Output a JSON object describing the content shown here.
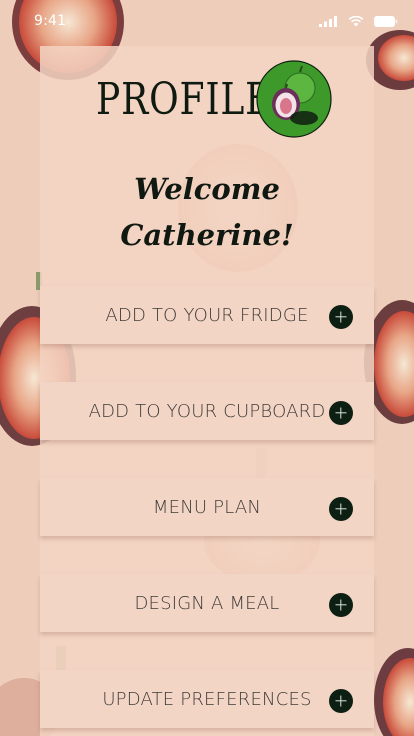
{
  "status_bar": {
    "time": "9:41"
  },
  "header": {
    "title": "PROFILE"
  },
  "welcome": {
    "line1": "Welcome",
    "line2": "Catherine!"
  },
  "menu": {
    "items": [
      {
        "label": "ADD TO YOUR FRIDGE"
      },
      {
        "label": "ADD TO YOUR CUPBOARD"
      },
      {
        "label": "MENU PLAN"
      },
      {
        "label": "DESIGN A MEAL"
      },
      {
        "label": "UPDATE PREFERENCES"
      }
    ]
  },
  "colors": {
    "background": "#eecdbb",
    "panel": "#f3d4c3",
    "accent_dark": "#0d1f12",
    "avatar_green": "#3d9a2a",
    "text": "#3e3a38"
  },
  "icons": {
    "avatar": "fig-icon",
    "menu_button": "plus-circle-icon",
    "status": [
      "signal-icon",
      "wifi-icon",
      "battery-icon"
    ]
  }
}
